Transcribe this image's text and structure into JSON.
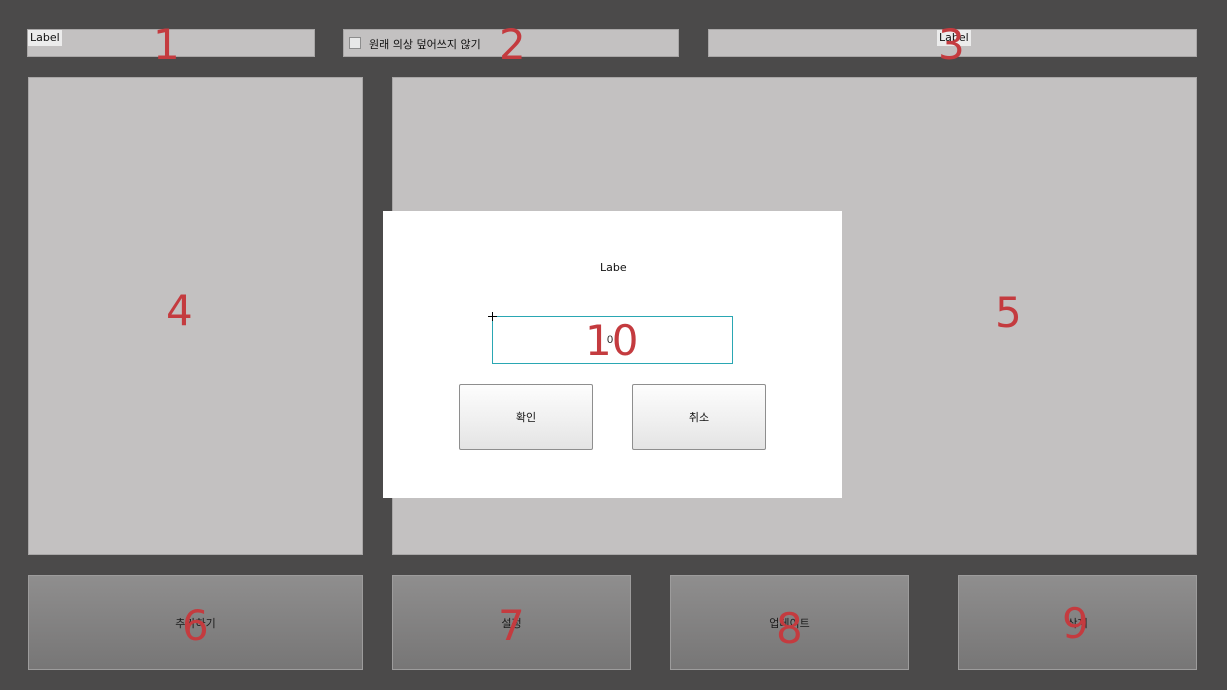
{
  "top_bar": {
    "label_left": "Label",
    "checkbox_label": "원래 의상 덮어쓰지 않기",
    "label_right": "Label"
  },
  "bottom_buttons": {
    "add": "추가하기",
    "settings": "설정",
    "update": "업데이트",
    "delete": "삭제"
  },
  "dialog": {
    "label": "Labe",
    "input_value": "0",
    "confirm": "확인",
    "cancel": "취소"
  },
  "annotations": [
    "1",
    "2",
    "3",
    "4",
    "5",
    "6",
    "7",
    "8",
    "9",
    "10"
  ],
  "colors": {
    "background": "#4b4a4a",
    "panel": "#c3c1c1",
    "annotation": "#c43b3f",
    "input_border": "#2aa7b3"
  }
}
